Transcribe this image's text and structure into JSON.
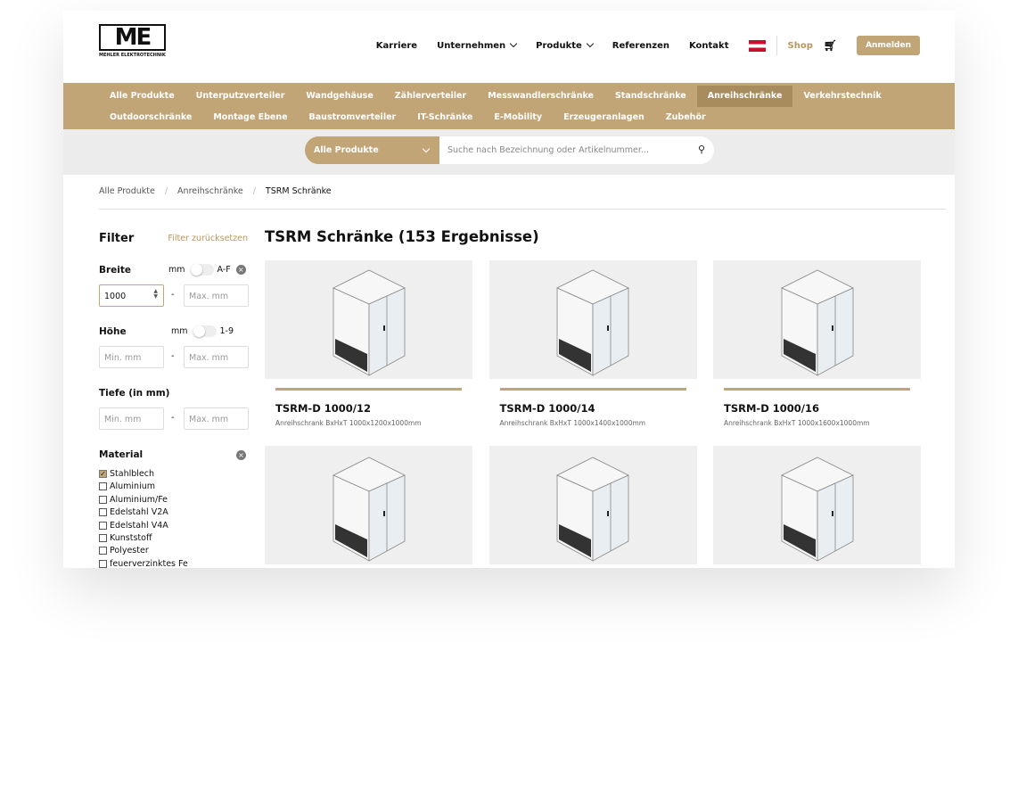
{
  "header": {
    "logo_text": "ME",
    "logo_sub": "MEHLER ELEKTROTECHNIK",
    "nav": [
      "Karriere",
      "Unternehmen",
      "Produkte",
      "Referenzen",
      "Kontakt"
    ],
    "shop": "Shop",
    "login": "Anmelden"
  },
  "categories": {
    "row1": [
      "Alle Produkte",
      "Unterputzverteiler",
      "Wandgehäuse",
      "Zählerverteiler",
      "Messwandlerschränke",
      "Standschränke",
      "Anreihschränke",
      "Verkehrstechnik"
    ],
    "row2": [
      "Outdoorschränke",
      "Montage Ebene",
      "Baustromverteiler",
      "IT-Schränke",
      "E-Mobility",
      "Erzeugeranlagen",
      "Zubehör"
    ],
    "active": "Anreihschränke"
  },
  "search": {
    "category": "Alle Produkte",
    "placeholder": "Suche nach Bezeichnung oder Artikelnummer..."
  },
  "breadcrumb": [
    "Alle Produkte",
    "Anreihschränke",
    "TSRM Schränke"
  ],
  "filter": {
    "title": "Filter",
    "reset": "Filter zurücksetzen",
    "breite": {
      "label": "Breite",
      "unit": "mm",
      "toggle": "A-F",
      "min": "1000",
      "max_ph": "Max. mm"
    },
    "hoehe": {
      "label": "Höhe",
      "unit": "mm",
      "toggle": "1-9",
      "min_ph": "Min. mm",
      "max_ph": "Max. mm"
    },
    "tiefe": {
      "label": "Tiefe (in mm)",
      "min_ph": "Min. mm",
      "max_ph": "Max. mm"
    },
    "material": {
      "label": "Material",
      "options": [
        {
          "label": "Stahlblech",
          "checked": true
        },
        {
          "label": "Aluminium",
          "checked": false
        },
        {
          "label": "Aluminium/Fe",
          "checked": false
        },
        {
          "label": "Edelstahl V2A",
          "checked": false
        },
        {
          "label": "Edelstahl V4A",
          "checked": false
        },
        {
          "label": "Kunststoff",
          "checked": false
        },
        {
          "label": "Polyester",
          "checked": false
        },
        {
          "label": "feuerverzinktes Fe",
          "checked": false
        }
      ]
    }
  },
  "results": {
    "title": "TSRM Schränke (153 Ergebnisse)",
    "products": [
      {
        "name": "TSRM-D 1000/12",
        "desc": "Anreihschrank BxHxT 1000x1200x1000mm"
      },
      {
        "name": "TSRM-D 1000/14",
        "desc": "Anreihschrank BxHxT 1000x1400x1000mm"
      },
      {
        "name": "TSRM-D 1000/16",
        "desc": "Anreihschrank BxHxT 1000x1600x1000mm"
      },
      {
        "name": "",
        "desc": ""
      },
      {
        "name": "",
        "desc": ""
      },
      {
        "name": "",
        "desc": ""
      }
    ]
  }
}
